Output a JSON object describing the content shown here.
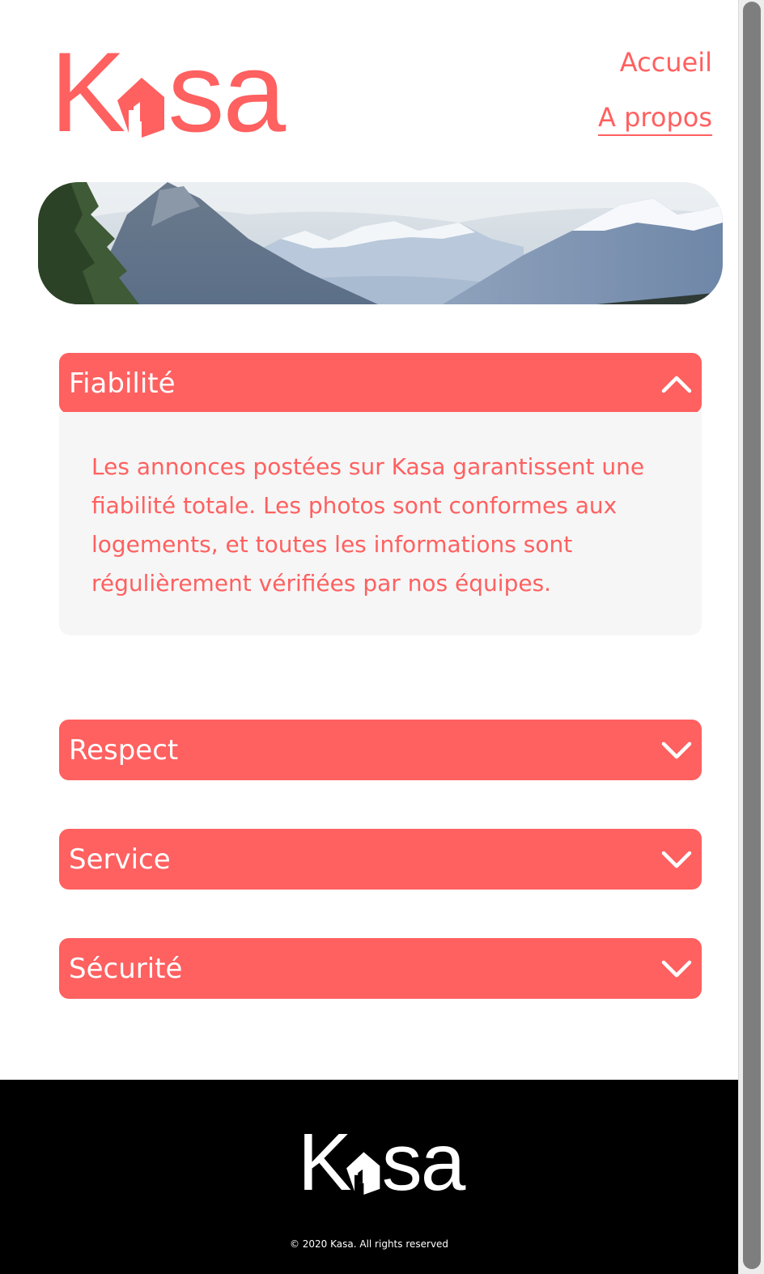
{
  "brand": {
    "logo_letters": [
      "K",
      "s",
      "a"
    ],
    "name": "Kasa",
    "color": "#FF6060"
  },
  "nav": {
    "home": "Accueil",
    "about": "A propos"
  },
  "banner": {
    "alt": "mountain-landscape"
  },
  "accordions": [
    {
      "title": "Fiabilité",
      "open": true,
      "icon": "chevron-up-icon",
      "content": "Les annonces postées sur Kasa garantissent une fiabilité totale. Les photos sont conformes aux logements, et toutes les informations sont régulièrement vérifiées par nos équipes."
    },
    {
      "title": "Respect",
      "open": false,
      "icon": "chevron-down-icon"
    },
    {
      "title": "Service",
      "open": false,
      "icon": "chevron-down-icon"
    },
    {
      "title": "Sécurité",
      "open": false,
      "icon": "chevron-down-icon"
    }
  ],
  "footer": {
    "copyright": "© 2020 Kasa. All rights reserved"
  },
  "colors": {
    "accent": "#FF6060",
    "panel": "#F6F6F6",
    "footer_bg": "#000000"
  }
}
